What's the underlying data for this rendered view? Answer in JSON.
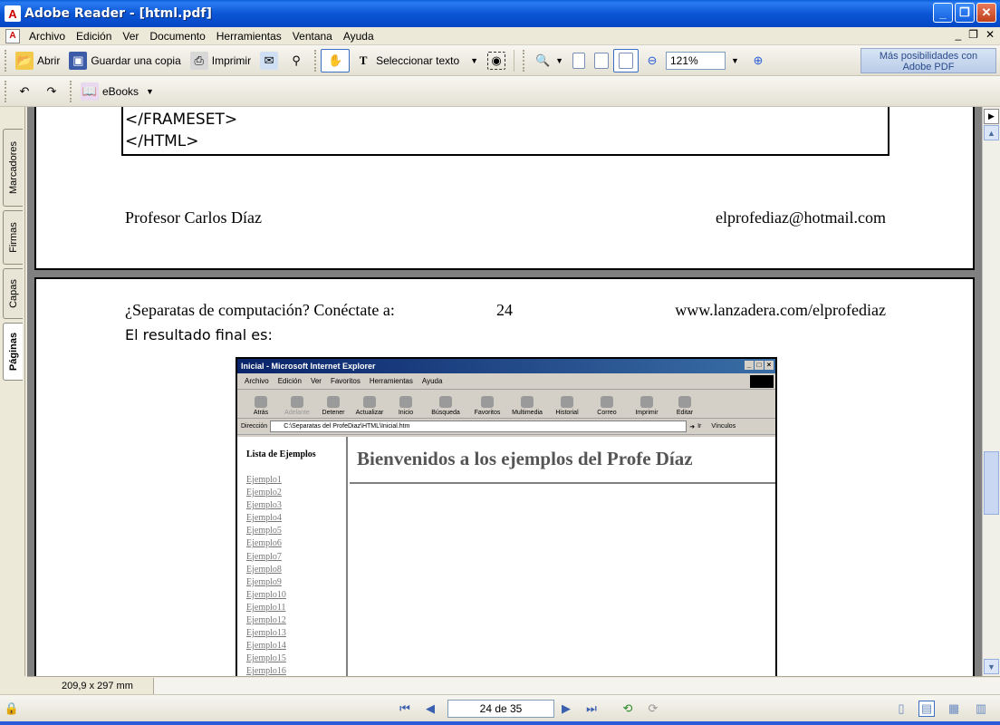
{
  "window": {
    "title": "Adobe Reader - [html.pdf]"
  },
  "menu": {
    "items": [
      "Archivo",
      "Edición",
      "Ver",
      "Documento",
      "Herramientas",
      "Ventana",
      "Ayuda"
    ]
  },
  "toolbar": {
    "open_label": "Abrir",
    "save_copy_label": "Guardar una copia",
    "print_label": "Imprimir",
    "select_text_label": "Seleccionar texto",
    "zoom_value": "121%",
    "promo_line1": "Más posibilidades con",
    "promo_line2": "Adobe PDF",
    "ebooks_label": "eBooks"
  },
  "side_tabs": [
    "Marcadores",
    "Firmas",
    "Capas",
    "Páginas"
  ],
  "document": {
    "code_lines": [
      "</FRAMESET>",
      "</HTML>"
    ],
    "footer_author": "Profesor Carlos Díaz",
    "footer_email": "elprofediaz@hotmail.com",
    "header_left": "¿Separatas de computación? Conéctate a:",
    "header_page": "24",
    "header_right": "www.lanzadera.com/elprofediaz",
    "result_label": "El resultado final es:"
  },
  "ie": {
    "title": "Inicial - Microsoft Internet Explorer",
    "menu": [
      "Archivo",
      "Edición",
      "Ver",
      "Favoritos",
      "Herramientas",
      "Ayuda"
    ],
    "tools": [
      "Atrás",
      "Adelante",
      "Detener",
      "Actualizar",
      "Inicio",
      "Búsqueda",
      "Favoritos",
      "Multimedia",
      "Historial",
      "Correo",
      "Imprimir",
      "Editar"
    ],
    "address_label": "Dirección",
    "address_value": "C:\\Separatas del ProfeDiaz\\HTML\\Inicial.htm",
    "go_label": "Ir",
    "links_label": "Vínculos",
    "sidebar_heading": "Lista de Ejemplos",
    "links": [
      "Ejemplo1",
      "Ejemplo2",
      "Ejemplo3",
      "Ejemplo4",
      "Ejemplo5",
      "Ejemplo6",
      "Ejemplo7",
      "Ejemplo8",
      "Ejemplo9",
      "Ejemplo10",
      "Ejemplo11",
      "Ejemplo12",
      "Ejemplo13",
      "Ejemplo14",
      "Ejemplo15",
      "Ejemplo16"
    ],
    "banner": "Bienvenidos a los ejemplos del Profe Díaz"
  },
  "status": {
    "page_size": "209,9 x 297 mm",
    "page_indicator": "24 de 35"
  }
}
